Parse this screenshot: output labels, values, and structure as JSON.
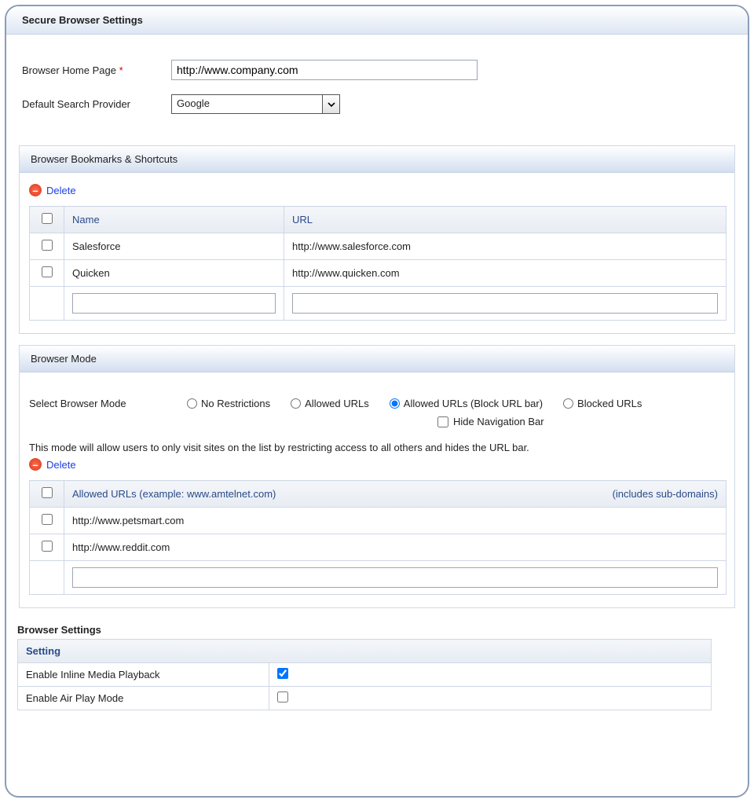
{
  "panel": {
    "title": "Secure Browser Settings"
  },
  "form": {
    "homepage_label": "Browser Home Page",
    "homepage_value": "http://www.company.com",
    "search_label": "Default Search Provider",
    "search_value": "Google"
  },
  "bookmarks": {
    "title": "Browser Bookmarks & Shortcuts",
    "delete_label": "Delete",
    "columns": {
      "name": "Name",
      "url": "URL"
    },
    "rows": [
      {
        "name": "Salesforce",
        "url": "http://www.salesforce.com"
      },
      {
        "name": "Quicken",
        "url": "http://www.quicken.com"
      }
    ]
  },
  "mode": {
    "title": "Browser Mode",
    "select_label": "Select Browser Mode",
    "options": {
      "no_restrictions": "No Restrictions",
      "allowed": "Allowed URLs",
      "allowed_block": "Allowed URLs (Block URL bar)",
      "blocked": "Blocked URLs"
    },
    "selected": "allowed_block",
    "hide_nav_label": "Hide Navigation Bar",
    "description": "This mode will allow users to only visit sites on the list by restricting access to all others and hides the URL bar.",
    "delete_label": "Delete",
    "table_header": "Allowed URLs (example: www.amtelnet.com)",
    "table_hint": "(includes sub-domains)",
    "rows": [
      {
        "url": "http://www.petsmart.com"
      },
      {
        "url": "http://www.reddit.com"
      }
    ]
  },
  "settings": {
    "heading": "Browser Settings",
    "column": "Setting",
    "rows": [
      {
        "label": "Enable Inline Media Playback",
        "checked": true
      },
      {
        "label": "Enable Air Play Mode",
        "checked": false
      }
    ]
  }
}
